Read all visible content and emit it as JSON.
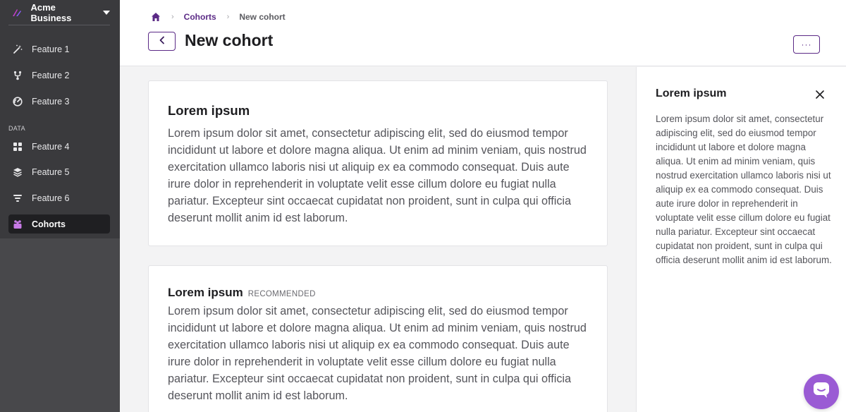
{
  "brand": {
    "name": "Acme Business",
    "logo_color": "#c13fc7"
  },
  "sidebar": {
    "items": [
      {
        "label": "Feature 1",
        "icon": "magic-wand-icon"
      },
      {
        "label": "Feature 2",
        "icon": "fork-icon"
      },
      {
        "label": "Feature 3",
        "icon": "gauge-icon"
      }
    ],
    "section_label": "DATA",
    "data_items": [
      {
        "label": "Feature 4",
        "icon": "grid-icon"
      },
      {
        "label": "Feature 5",
        "icon": "layers-icon"
      },
      {
        "label": "Feature 6",
        "icon": "filter-icon"
      },
      {
        "label": "Cohorts",
        "icon": "people-icon",
        "active": true
      }
    ]
  },
  "header": {
    "breadcrumb": {
      "home_icon": "home-icon",
      "link": "Cohorts",
      "current": "New cohort"
    },
    "title": "New cohort",
    "more_label": "···"
  },
  "main": {
    "card1": {
      "title": "Lorem ipsum",
      "body": "Lorem ipsum dolor sit amet, consectetur adipiscing elit, sed do eiusmod tempor incididunt ut labore et dolore magna aliqua. Ut enim ad minim veniam, quis nostrud exercitation ullamco laboris nisi ut aliquip ex ea commodo consequat. Duis aute irure dolor in reprehenderit in voluptate velit esse cillum dolore eu fugiat nulla pariatur. Excepteur sint occaecat cupidatat non proident, sunt in culpa qui officia deserunt mollit anim id est laborum."
    },
    "card2": {
      "title": "Lorem ipsum",
      "badge": "RECOMMENDED",
      "body": "Lorem ipsum dolor sit amet, consectetur adipiscing elit, sed do eiusmod tempor incididunt ut labore et dolore magna aliqua. Ut enim ad minim veniam, quis nostrud exercitation ullamco laboris nisi ut aliquip ex ea commodo consequat. Duis aute irure dolor in reprehenderit in voluptate velit esse cillum dolore eu fugiat nulla pariatur. Excepteur sint occaecat cupidatat non proident, sunt in culpa qui officia deserunt mollit anim id est laborum."
    }
  },
  "side_panel": {
    "title": "Lorem ipsum",
    "body": "Lorem ipsum dolor sit amet, consectetur adipiscing elit, sed do eiusmod tempor incididunt ut labore et dolore magna aliqua. Ut enim ad minim veniam, quis nostrud exercitation ullamco laboris nisi ut aliquip ex ea commodo consequat. Duis aute irure dolor in reprehenderit in voluptate velit esse cillum dolore eu fugiat nulla pariatur. Excepteur sint occaecat cupidatat non proident, sunt in culpa qui officia deserunt mollit anim id est laborum."
  },
  "colors": {
    "accent": "#5b2a86",
    "chat": "#9a5bd4",
    "sidebar": "#3a3a3d"
  }
}
